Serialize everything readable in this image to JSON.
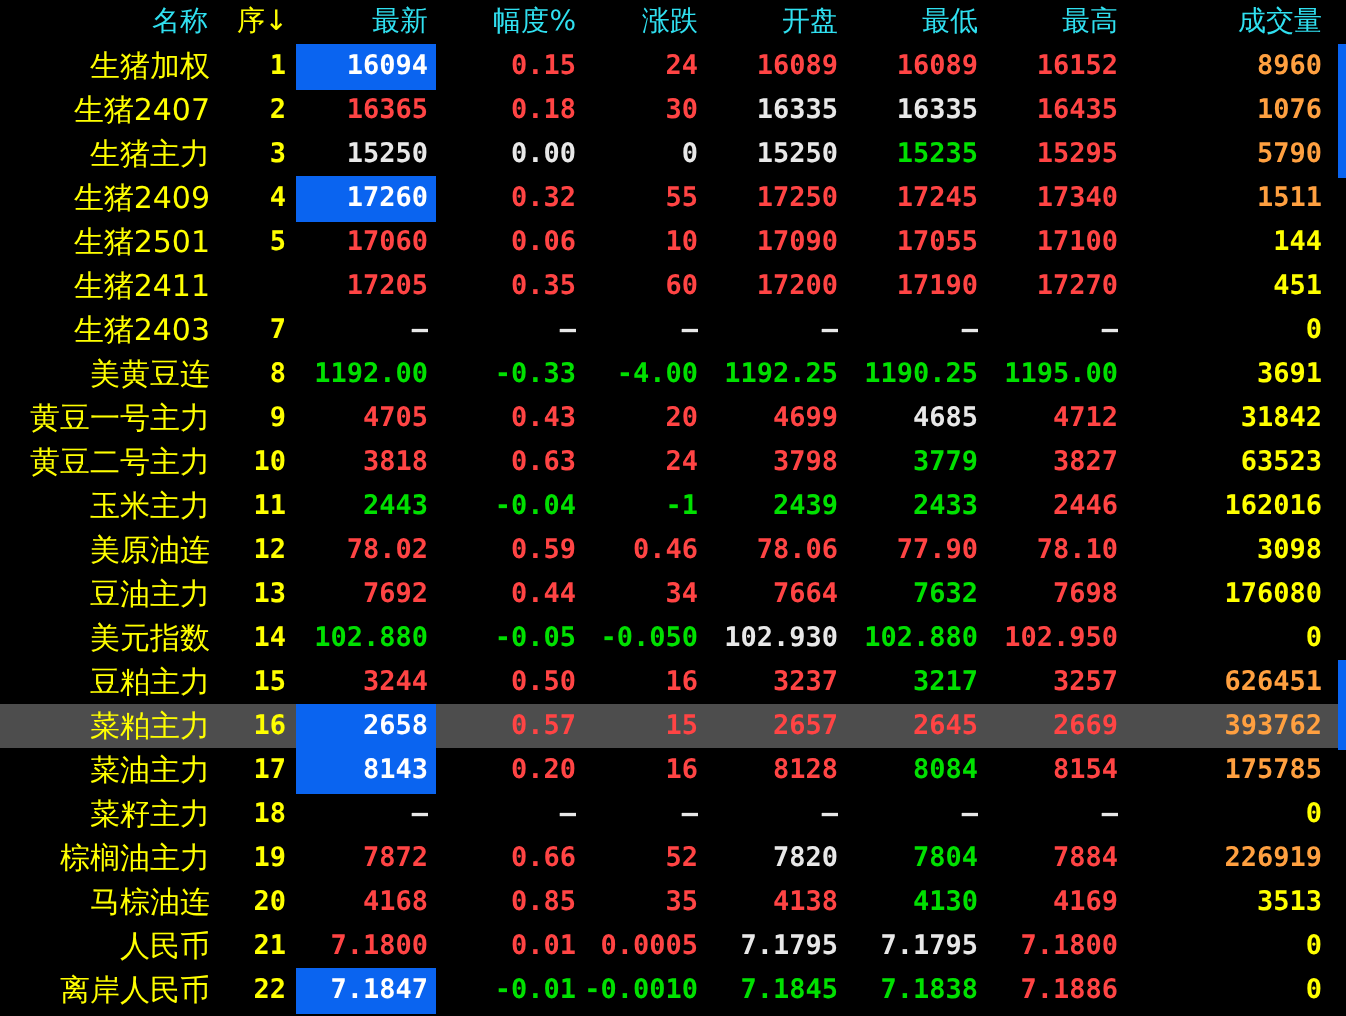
{
  "columns": [
    {
      "label": "名称",
      "color": "#30e0f0"
    },
    {
      "label": "序↓",
      "color": "#ffff00"
    },
    {
      "label": "最新",
      "color": "#30e0f0"
    },
    {
      "label": "幅度%",
      "color": "#30e0f0"
    },
    {
      "label": "涨跌",
      "color": "#30e0f0"
    },
    {
      "label": "开盘",
      "color": "#30e0f0"
    },
    {
      "label": "最低",
      "color": "#30e0f0"
    },
    {
      "label": "最高",
      "color": "#30e0f0"
    },
    {
      "label": "成交量",
      "color": "#30e0f0"
    }
  ],
  "rows": [
    {
      "name": "生猪加权",
      "seq": "1",
      "selected": false,
      "marked": true,
      "highlighted": true,
      "cells": [
        {
          "text": "16094",
          "color": "#ffffff"
        },
        {
          "text": "0.15",
          "color": "#ff4444"
        },
        {
          "text": "24",
          "color": "#ff4444"
        },
        {
          "text": "16089",
          "color": "#ff4444"
        },
        {
          "text": "16089",
          "color": "#ff4444"
        },
        {
          "text": "16152",
          "color": "#ff4444"
        },
        {
          "text": "8960",
          "color": "#ffa040"
        }
      ]
    },
    {
      "name": "生猪2407",
      "seq": "2",
      "selected": false,
      "marked": true,
      "highlighted": false,
      "cells": [
        {
          "text": "16365",
          "color": "#ff4444"
        },
        {
          "text": "0.18",
          "color": "#ff4444"
        },
        {
          "text": "30",
          "color": "#ff4444"
        },
        {
          "text": "16335",
          "color": "#e8e8e8"
        },
        {
          "text": "16335",
          "color": "#e8e8e8"
        },
        {
          "text": "16435",
          "color": "#ff4444"
        },
        {
          "text": "1076",
          "color": "#ffa040"
        }
      ]
    },
    {
      "name": "生猪主力",
      "seq": "3",
      "selected": false,
      "marked": true,
      "highlighted": false,
      "cells": [
        {
          "text": "15250",
          "color": "#e8e8e8"
        },
        {
          "text": "0.00",
          "color": "#e8e8e8"
        },
        {
          "text": "0",
          "color": "#e8e8e8"
        },
        {
          "text": "15250",
          "color": "#e8e8e8"
        },
        {
          "text": "15235",
          "color": "#00e000"
        },
        {
          "text": "15295",
          "color": "#ff4444"
        },
        {
          "text": "5790",
          "color": "#ffa040"
        }
      ]
    },
    {
      "name": "生猪2409",
      "seq": "4",
      "selected": false,
      "marked": false,
      "highlighted": true,
      "cells": [
        {
          "text": "17260",
          "color": "#ffffff"
        },
        {
          "text": "0.32",
          "color": "#ff4444"
        },
        {
          "text": "55",
          "color": "#ff4444"
        },
        {
          "text": "17250",
          "color": "#ff4444"
        },
        {
          "text": "17245",
          "color": "#ff4444"
        },
        {
          "text": "17340",
          "color": "#ff4444"
        },
        {
          "text": "1511",
          "color": "#ffa040"
        }
      ]
    },
    {
      "name": "生猪2501",
      "seq": "5",
      "selected": false,
      "marked": false,
      "highlighted": false,
      "cells": [
        {
          "text": "17060",
          "color": "#ff4444"
        },
        {
          "text": "0.06",
          "color": "#ff4444"
        },
        {
          "text": "10",
          "color": "#ff4444"
        },
        {
          "text": "17090",
          "color": "#ff4444"
        },
        {
          "text": "17055",
          "color": "#ff4444"
        },
        {
          "text": "17100",
          "color": "#ff4444"
        },
        {
          "text": "144",
          "color": "#ffff00"
        }
      ]
    },
    {
      "name": "生猪2411",
      "selected": false,
      "marked": false,
      "highlighted": false,
      "cells": [
        {
          "text": "17205",
          "color": "#ff4444"
        },
        {
          "text": "0.35",
          "color": "#ff4444"
        },
        {
          "text": "60",
          "color": "#ff4444"
        },
        {
          "text": "17200",
          "color": "#ff4444"
        },
        {
          "text": "17190",
          "color": "#ff4444"
        },
        {
          "text": "17270",
          "color": "#ff4444"
        },
        {
          "text": "451",
          "color": "#ffff00"
        }
      ]
    },
    {
      "name": "生猪2403",
      "seq": "7",
      "selected": false,
      "marked": false,
      "highlighted": false,
      "cells": [
        {
          "text": "—",
          "color": "#e8e8e8"
        },
        {
          "text": "—",
          "color": "#e8e8e8"
        },
        {
          "text": "—",
          "color": "#e8e8e8"
        },
        {
          "text": "—",
          "color": "#e8e8e8"
        },
        {
          "text": "—",
          "color": "#e8e8e8"
        },
        {
          "text": "—",
          "color": "#e8e8e8"
        },
        {
          "text": "0",
          "color": "#ffff00"
        }
      ]
    },
    {
      "name": "美黄豆连",
      "seq": "8",
      "selected": false,
      "marked": false,
      "highlighted": false,
      "cells": [
        {
          "text": "1192.00",
          "color": "#00e000"
        },
        {
          "text": "-0.33",
          "color": "#00e000"
        },
        {
          "text": "-4.00",
          "color": "#00e000"
        },
        {
          "text": "1192.25",
          "color": "#00e000"
        },
        {
          "text": "1190.25",
          "color": "#00e000"
        },
        {
          "text": "1195.00",
          "color": "#00e000"
        },
        {
          "text": "3691",
          "color": "#ffff00"
        }
      ]
    },
    {
      "name": "黄豆一号主力",
      "seq": "9",
      "selected": false,
      "marked": false,
      "highlighted": false,
      "cells": [
        {
          "text": "4705",
          "color": "#ff4444"
        },
        {
          "text": "0.43",
          "color": "#ff4444"
        },
        {
          "text": "20",
          "color": "#ff4444"
        },
        {
          "text": "4699",
          "color": "#ff4444"
        },
        {
          "text": "4685",
          "color": "#e8e8e8"
        },
        {
          "text": "4712",
          "color": "#ff4444"
        },
        {
          "text": "31842",
          "color": "#ffff00"
        }
      ]
    },
    {
      "name": "黄豆二号主力",
      "seq": "10",
      "selected": false,
      "marked": false,
      "highlighted": false,
      "cells": [
        {
          "text": "3818",
          "color": "#ff4444"
        },
        {
          "text": "0.63",
          "color": "#ff4444"
        },
        {
          "text": "24",
          "color": "#ff4444"
        },
        {
          "text": "3798",
          "color": "#ff4444"
        },
        {
          "text": "3779",
          "color": "#00e000"
        },
        {
          "text": "3827",
          "color": "#ff4444"
        },
        {
          "text": "63523",
          "color": "#ffff00"
        }
      ]
    },
    {
      "name": "玉米主力",
      "seq": "11",
      "selected": false,
      "marked": false,
      "highlighted": false,
      "cells": [
        {
          "text": "2443",
          "color": "#00e000"
        },
        {
          "text": "-0.04",
          "color": "#00e000"
        },
        {
          "text": "-1",
          "color": "#00e000"
        },
        {
          "text": "2439",
          "color": "#00e000"
        },
        {
          "text": "2433",
          "color": "#00e000"
        },
        {
          "text": "2446",
          "color": "#ff4444"
        },
        {
          "text": "162016",
          "color": "#ffff00"
        }
      ]
    },
    {
      "name": "美原油连",
      "seq": "12",
      "selected": false,
      "marked": false,
      "highlighted": false,
      "cells": [
        {
          "text": "78.02",
          "color": "#ff4444"
        },
        {
          "text": "0.59",
          "color": "#ff4444"
        },
        {
          "text": "0.46",
          "color": "#ff4444"
        },
        {
          "text": "78.06",
          "color": "#ff4444"
        },
        {
          "text": "77.90",
          "color": "#ff4444"
        },
        {
          "text": "78.10",
          "color": "#ff4444"
        },
        {
          "text": "3098",
          "color": "#ffff00"
        }
      ]
    },
    {
      "name": "豆油主力",
      "seq": "13",
      "selected": false,
      "marked": false,
      "highlighted": false,
      "cells": [
        {
          "text": "7692",
          "color": "#ff4444"
        },
        {
          "text": "0.44",
          "color": "#ff4444"
        },
        {
          "text": "34",
          "color": "#ff4444"
        },
        {
          "text": "7664",
          "color": "#ff4444"
        },
        {
          "text": "7632",
          "color": "#00e000"
        },
        {
          "text": "7698",
          "color": "#ff4444"
        },
        {
          "text": "176080",
          "color": "#ffff00"
        }
      ]
    },
    {
      "name": "美元指数",
      "seq": "14",
      "selected": false,
      "marked": false,
      "highlighted": false,
      "cells": [
        {
          "text": "102.880",
          "color": "#00e000"
        },
        {
          "text": "-0.05",
          "color": "#00e000"
        },
        {
          "text": "-0.050",
          "color": "#00e000"
        },
        {
          "text": "102.930",
          "color": "#e8e8e8"
        },
        {
          "text": "102.880",
          "color": "#00e000"
        },
        {
          "text": "102.950",
          "color": "#ff4444"
        },
        {
          "text": "0",
          "color": "#ffff00"
        }
      ]
    },
    {
      "name": "豆粕主力",
      "seq": "15",
      "selected": false,
      "marked": true,
      "highlighted": false,
      "cells": [
        {
          "text": "3244",
          "color": "#ff4444"
        },
        {
          "text": "0.50",
          "color": "#ff4444"
        },
        {
          "text": "16",
          "color": "#ff4444"
        },
        {
          "text": "3237",
          "color": "#ff4444"
        },
        {
          "text": "3217",
          "color": "#00e000"
        },
        {
          "text": "3257",
          "color": "#ff4444"
        },
        {
          "text": "626451",
          "color": "#ffa040"
        }
      ]
    },
    {
      "name": "菜粕主力",
      "seq": "16",
      "selected": true,
      "marked": true,
      "highlighted": true,
      "cells": [
        {
          "text": "2658",
          "color": "#ffffff"
        },
        {
          "text": "0.57",
          "color": "#ff4444"
        },
        {
          "text": "15",
          "color": "#ff4444"
        },
        {
          "text": "2657",
          "color": "#ff4444"
        },
        {
          "text": "2645",
          "color": "#ff4444"
        },
        {
          "text": "2669",
          "color": "#ff4444"
        },
        {
          "text": "393762",
          "color": "#ffa040"
        }
      ]
    },
    {
      "name": "菜油主力",
      "seq": "17",
      "selected": false,
      "marked": false,
      "highlighted": true,
      "cells": [
        {
          "text": "8143",
          "color": "#ffffff"
        },
        {
          "text": "0.20",
          "color": "#ff4444"
        },
        {
          "text": "16",
          "color": "#ff4444"
        },
        {
          "text": "8128",
          "color": "#ff4444"
        },
        {
          "text": "8084",
          "color": "#00e000"
        },
        {
          "text": "8154",
          "color": "#ff4444"
        },
        {
          "text": "175785",
          "color": "#ffa040"
        }
      ]
    },
    {
      "name": "菜籽主力",
      "seq": "18",
      "selected": false,
      "marked": false,
      "highlighted": false,
      "cells": [
        {
          "text": "—",
          "color": "#e8e8e8"
        },
        {
          "text": "—",
          "color": "#e8e8e8"
        },
        {
          "text": "—",
          "color": "#e8e8e8"
        },
        {
          "text": "—",
          "color": "#e8e8e8"
        },
        {
          "text": "—",
          "color": "#e8e8e8"
        },
        {
          "text": "—",
          "color": "#e8e8e8"
        },
        {
          "text": "0",
          "color": "#ffff00"
        }
      ]
    },
    {
      "name": "棕榈油主力",
      "seq": "19",
      "selected": false,
      "marked": false,
      "highlighted": false,
      "cells": [
        {
          "text": "7872",
          "color": "#ff4444"
        },
        {
          "text": "0.66",
          "color": "#ff4444"
        },
        {
          "text": "52",
          "color": "#ff4444"
        },
        {
          "text": "7820",
          "color": "#e8e8e8"
        },
        {
          "text": "7804",
          "color": "#00e000"
        },
        {
          "text": "7884",
          "color": "#ff4444"
        },
        {
          "text": "226919",
          "color": "#ffa040"
        }
      ]
    },
    {
      "name": "马棕油连",
      "seq": "20",
      "selected": false,
      "marked": false,
      "highlighted": false,
      "cells": [
        {
          "text": "4168",
          "color": "#ff4444"
        },
        {
          "text": "0.85",
          "color": "#ff4444"
        },
        {
          "text": "35",
          "color": "#ff4444"
        },
        {
          "text": "4138",
          "color": "#ff4444"
        },
        {
          "text": "4130",
          "color": "#00e000"
        },
        {
          "text": "4169",
          "color": "#ff4444"
        },
        {
          "text": "3513",
          "color": "#ffff00"
        }
      ]
    },
    {
      "name": "人民币",
      "seq": "21",
      "selected": false,
      "marked": false,
      "highlighted": false,
      "cells": [
        {
          "text": "7.1800",
          "color": "#ff4444"
        },
        {
          "text": "0.01",
          "color": "#ff4444"
        },
        {
          "text": "0.0005",
          "color": "#ff4444"
        },
        {
          "text": "7.1795",
          "color": "#e8e8e8"
        },
        {
          "text": "7.1795",
          "color": "#e8e8e8"
        },
        {
          "text": "7.1800",
          "color": "#ff4444"
        },
        {
          "text": "0",
          "color": "#ffff00"
        }
      ]
    },
    {
      "name": "离岸人民币",
      "seq": "22",
      "selected": false,
      "marked": false,
      "highlighted": true,
      "cells": [
        {
          "text": "7.1847",
          "color": "#ffffff"
        },
        {
          "text": "-0.01",
          "color": "#00e000"
        },
        {
          "text": "-0.0010",
          "color": "#00e000"
        },
        {
          "text": "7.1845",
          "color": "#00e000"
        },
        {
          "text": "7.1838",
          "color": "#00e000"
        },
        {
          "text": "7.1886",
          "color": "#ff4444"
        },
        {
          "text": "0",
          "color": "#ffff00"
        }
      ]
    }
  ]
}
